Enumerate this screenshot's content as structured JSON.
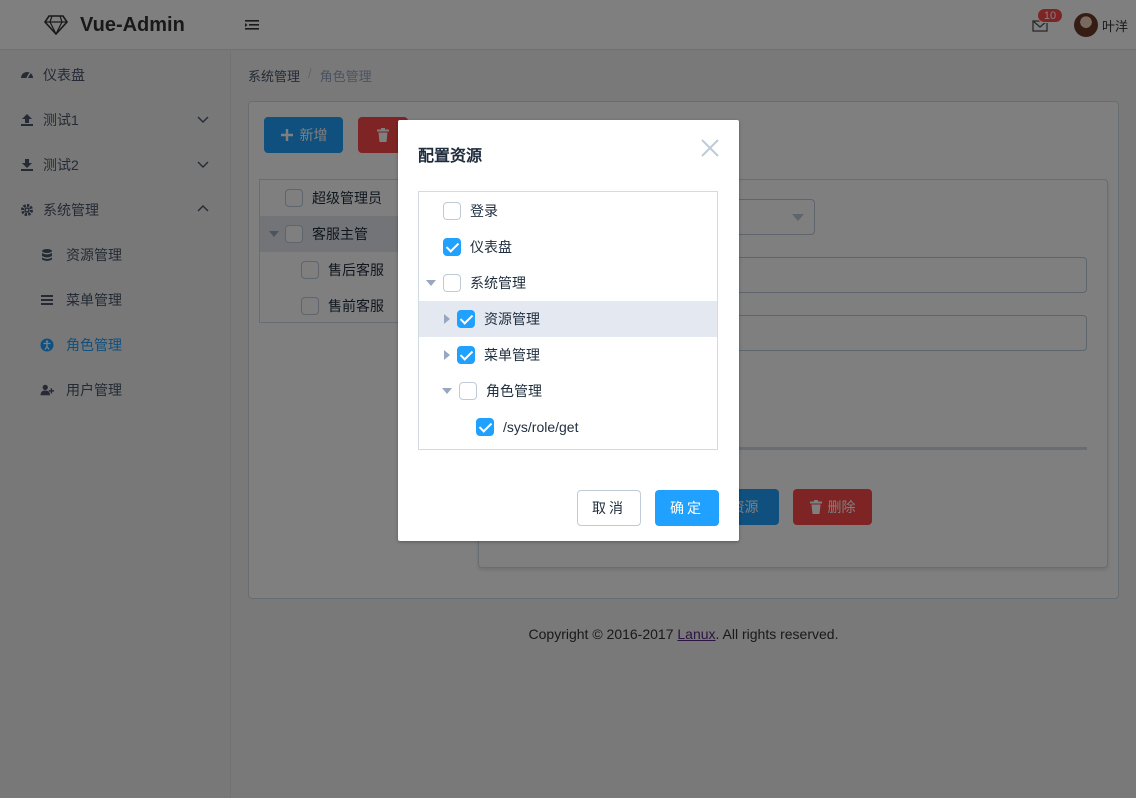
{
  "header": {
    "brand": "Vue-Admin",
    "mail_badge": "10",
    "username": "叶洋"
  },
  "sidebar": {
    "items": [
      {
        "label": "仪表盘"
      },
      {
        "label": "测试1"
      },
      {
        "label": "测试2"
      },
      {
        "label": "系统管理"
      },
      {
        "label": "资源管理"
      },
      {
        "label": "菜单管理"
      },
      {
        "label": "角色管理"
      },
      {
        "label": "用户管理"
      }
    ]
  },
  "breadcrumb": {
    "parent": "系统管理",
    "separator": "/",
    "current": "角色管理"
  },
  "toolbar": {
    "add_label": "新增",
    "delete_label": "删除"
  },
  "roles": [
    {
      "label": "超级管理员",
      "checked": false
    },
    {
      "label": "客服主管",
      "checked": false,
      "expanded": true
    },
    {
      "label": "售后客服",
      "checked": false
    },
    {
      "label": "售前客服",
      "checked": false
    }
  ],
  "detail": {
    "resource_button": "资源",
    "delete_button": "删除"
  },
  "footer": {
    "prefix": "Copyright © 2016-2017 ",
    "link": "Lanux",
    "suffix": ". All rights reserved."
  },
  "dialog": {
    "title": "配置资源",
    "tree": [
      {
        "label": "登录",
        "checked": true
      },
      {
        "label": "仪表盘",
        "checked": true
      },
      {
        "label": "系统管理",
        "checked": false,
        "expanded": true
      },
      {
        "label": "资源管理",
        "checked": true,
        "expanded": false
      },
      {
        "label": "菜单管理",
        "checked": true,
        "expanded": false
      },
      {
        "label": "角色管理",
        "checked": false,
        "expanded": true
      },
      {
        "label": "/sys/role/get",
        "checked": true
      }
    ],
    "cancel_label": "取消",
    "ok_label": "确定"
  },
  "colors": {
    "primary": "#20a0ff",
    "danger": "#ff4949",
    "active_nav": "#20a0ff"
  }
}
